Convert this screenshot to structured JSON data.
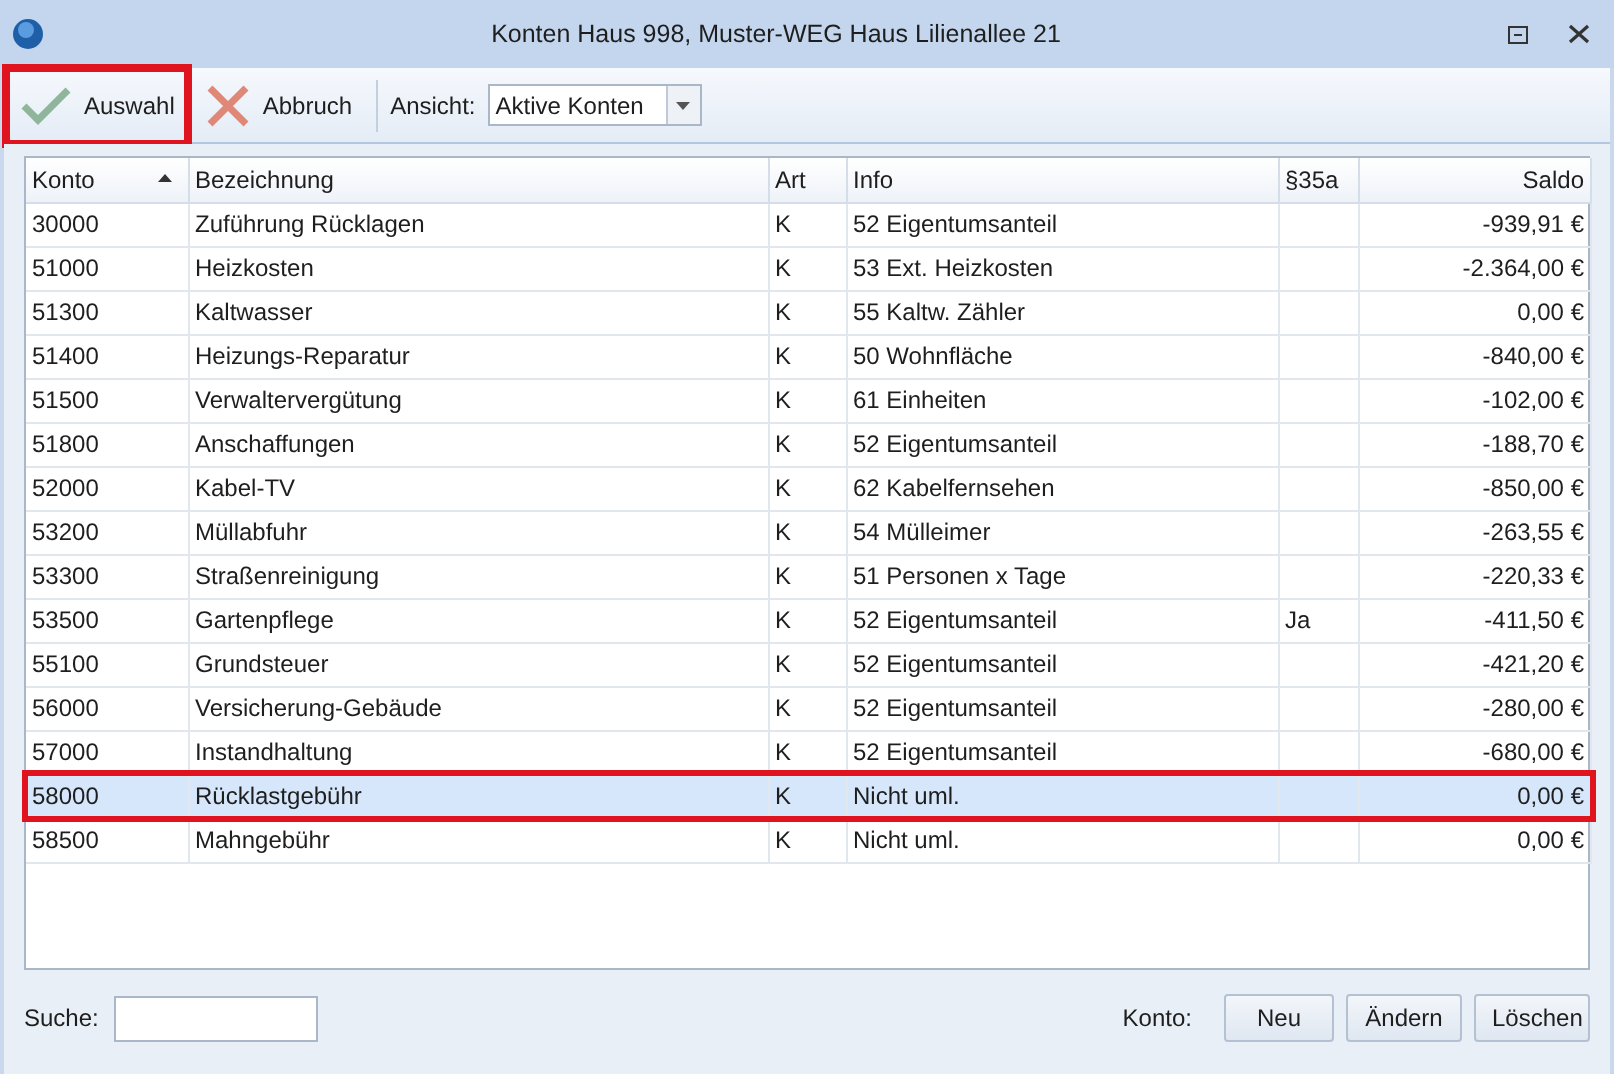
{
  "window": {
    "title": "Konten Haus 998, Muster-WEG Haus Lilienallee 21"
  },
  "toolbar": {
    "buttons": [
      {
        "kind": "confirm",
        "label": "Auswahl",
        "highlighted": true
      },
      {
        "kind": "cancel",
        "label": "Abbruch",
        "highlighted": false
      }
    ],
    "view_label": "Ansicht:",
    "view_value": "Aktive Konten"
  },
  "table": {
    "columns": [
      {
        "label": "Konto",
        "sorted": true,
        "right_aligned": false
      },
      {
        "label": "Bezeichnung",
        "sorted": false,
        "right_aligned": false
      },
      {
        "label": "Art",
        "sorted": false,
        "right_aligned": false
      },
      {
        "label": "Info",
        "sorted": false,
        "right_aligned": false
      },
      {
        "label": "§35a",
        "sorted": false,
        "right_aligned": false
      },
      {
        "label": "Saldo",
        "sorted": false,
        "right_aligned": true
      }
    ],
    "rows": [
      {
        "cells": [
          "30000",
          "Zuführung Rücklagen",
          "K",
          "52 Eigentumsanteil",
          "",
          "-939,91 €"
        ],
        "selected": false,
        "highlighted": false
      },
      {
        "cells": [
          "51000",
          "Heizkosten",
          "K",
          "53 Ext. Heizkosten",
          "",
          "-2.364,00 €"
        ],
        "selected": false,
        "highlighted": false
      },
      {
        "cells": [
          "51300",
          "Kaltwasser",
          "K",
          "55 Kaltw. Zähler",
          "",
          "0,00 €"
        ],
        "selected": false,
        "highlighted": false
      },
      {
        "cells": [
          "51400",
          "Heizungs-Reparatur",
          "K",
          "50 Wohnfläche",
          "",
          "-840,00 €"
        ],
        "selected": false,
        "highlighted": false
      },
      {
        "cells": [
          "51500",
          "Verwaltervergütung",
          "K",
          "61 Einheiten",
          "",
          "-102,00 €"
        ],
        "selected": false,
        "highlighted": false
      },
      {
        "cells": [
          "51800",
          "Anschaffungen",
          "K",
          "52 Eigentumsanteil",
          "",
          "-188,70 €"
        ],
        "selected": false,
        "highlighted": false
      },
      {
        "cells": [
          "52000",
          "Kabel-TV",
          "K",
          "62 Kabelfernsehen",
          "",
          "-850,00 €"
        ],
        "selected": false,
        "highlighted": false
      },
      {
        "cells": [
          "53200",
          "Müllabfuhr",
          "K",
          "54 Mülleimer",
          "",
          "-263,55 €"
        ],
        "selected": false,
        "highlighted": false
      },
      {
        "cells": [
          "53300",
          "Straßenreinigung",
          "K",
          "51 Personen x Tage",
          "",
          "-220,33 €"
        ],
        "selected": false,
        "highlighted": false
      },
      {
        "cells": [
          "53500",
          "Gartenpflege",
          "K",
          "52 Eigentumsanteil",
          "Ja",
          "-411,50 €"
        ],
        "selected": false,
        "highlighted": false
      },
      {
        "cells": [
          "55100",
          "Grundsteuer",
          "K",
          "52 Eigentumsanteil",
          "",
          "-421,20 €"
        ],
        "selected": false,
        "highlighted": false
      },
      {
        "cells": [
          "56000",
          "Versicherung-Gebäude",
          "K",
          "52 Eigentumsanteil",
          "",
          "-280,00 €"
        ],
        "selected": false,
        "highlighted": false
      },
      {
        "cells": [
          "57000",
          "Instandhaltung",
          "K",
          "52 Eigentumsanteil",
          "",
          "-680,00 €"
        ],
        "selected": false,
        "highlighted": false
      },
      {
        "cells": [
          "58000",
          "Rücklastgebühr",
          "K",
          "Nicht uml.",
          "",
          "0,00 €"
        ],
        "selected": true,
        "highlighted": true
      },
      {
        "cells": [
          "58500",
          "Mahngebühr",
          "K",
          "Nicht uml.",
          "",
          "0,00 €"
        ],
        "selected": false,
        "highlighted": false
      }
    ]
  },
  "footer": {
    "search_label": "Suche:",
    "konto_label": "Konto:",
    "buttons": [
      "Neu",
      "Ändern",
      "Löschen"
    ]
  }
}
